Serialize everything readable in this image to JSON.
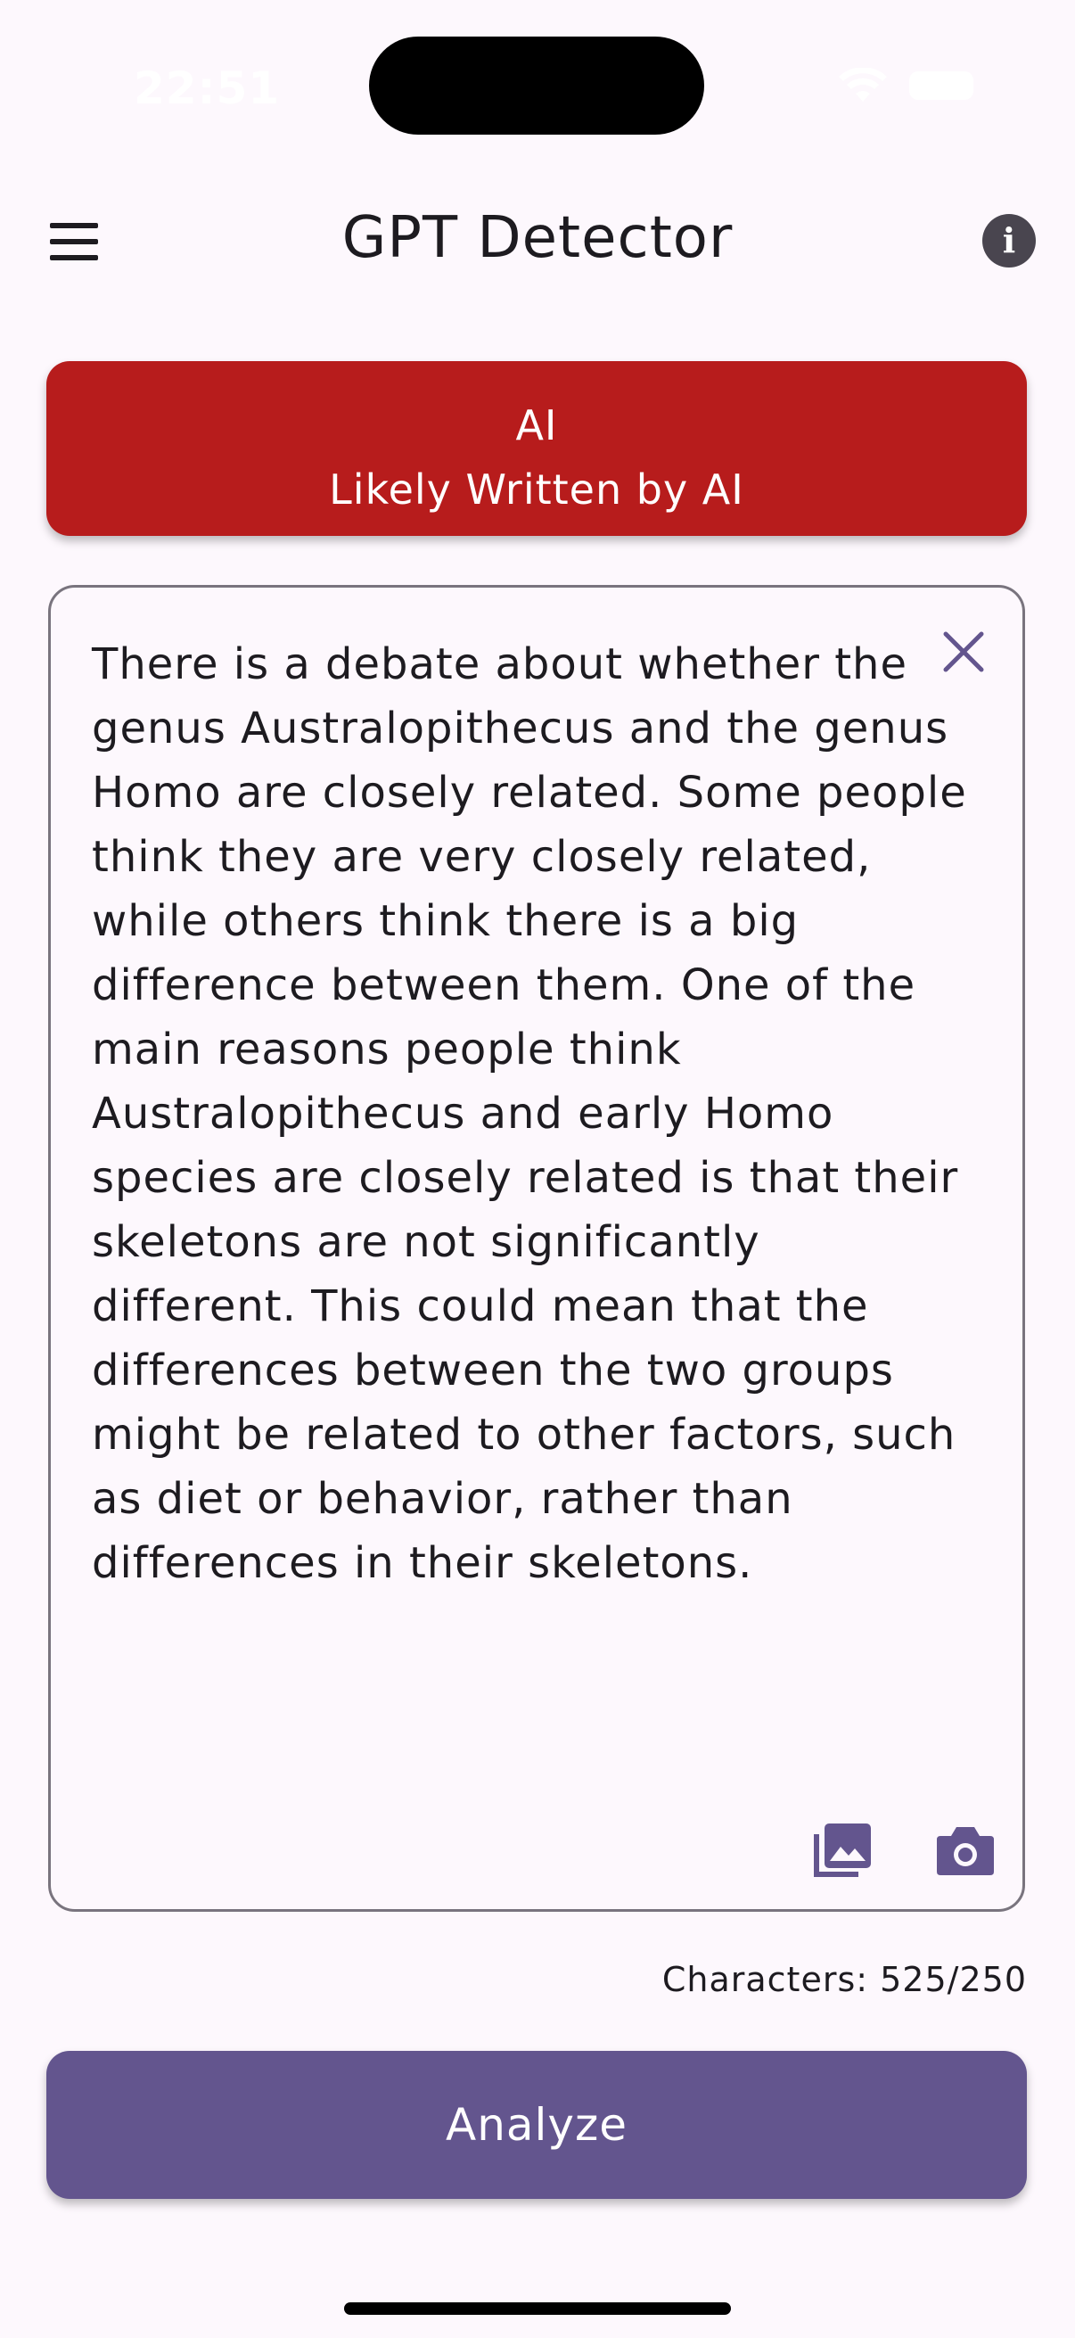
{
  "status_bar": {
    "time": "22:51"
  },
  "app_bar": {
    "title": "GPT Detector",
    "menu_icon": "hamburger-menu-icon",
    "info_icon": "info-icon",
    "info_glyph": "i"
  },
  "result": {
    "label": "AI",
    "verdict": "Likely Written by AI",
    "color": "#B71C1C"
  },
  "input": {
    "text": "There is a debate about whether the genus Australopithecus and the genus Homo are closely related. Some people think they are very closely related, while others think there is a big difference between them. One of the main reasons people think Australopithecus and early Homo species are closely related is that their skeletons are not significantly different. This could mean that the differences between the two groups might be related to other factors, such as diet or behavior, rather than differences in their skeletons.",
    "clear_icon": "close-icon",
    "gallery_icon": "photo-library-icon",
    "camera_icon": "camera-icon"
  },
  "character_count": "Characters: 525/250",
  "actions": {
    "analyze_label": "Analyze",
    "accent": "#63558E"
  }
}
